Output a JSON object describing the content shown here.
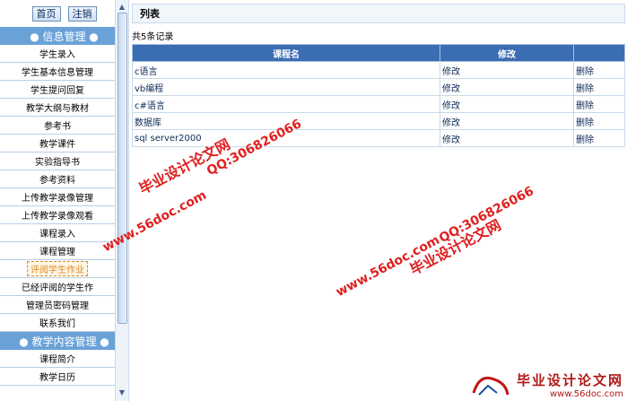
{
  "top": {
    "home": "首页",
    "logout": "注销"
  },
  "sections": {
    "info": "● 信息管理 ●",
    "teaching": "● 教学内容管理 ●"
  },
  "menu": [
    "学生录入",
    "学生基本信息管理",
    "学生提问回复",
    "教学大纲与教材",
    "参考书",
    "教学课件",
    "实验指导书",
    "参考资料",
    "上传教学录像管理",
    "上传教学录像观看",
    "课程录入",
    "课程管理",
    "评阅学生作业",
    "已经评阅的学生作",
    "管理员密码管理",
    "联系我们"
  ],
  "menu2": [
    "课程简介",
    "教学日历"
  ],
  "header": {
    "title": "列表"
  },
  "count": "共5条记录",
  "table": {
    "headers": [
      "课程名",
      "修改",
      ""
    ],
    "rows": [
      {
        "name": "c语言",
        "edit": "修改",
        "del": "删除"
      },
      {
        "name": "vb编程",
        "edit": "修改",
        "del": "删除"
      },
      {
        "name": "c#语言",
        "edit": "修改",
        "del": "删除"
      },
      {
        "name": "数据库",
        "edit": "修改",
        "del": "删除"
      },
      {
        "name": "sql server2000",
        "edit": "修改",
        "del": "删除"
      }
    ]
  },
  "watermarks": {
    "w1": "毕业设计论文网",
    "w2": "QQ:306826066",
    "w3": "www.56doc.com",
    "w4": "www.56doc.com",
    "w5": "QQ:306826066",
    "w6": "毕业设计论文网"
  },
  "footer": {
    "logo_text": "毕业设计论文网",
    "url": "www.56doc.com"
  }
}
